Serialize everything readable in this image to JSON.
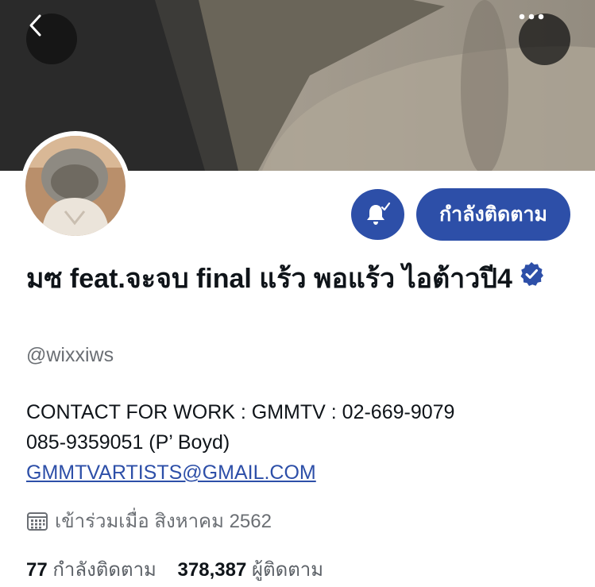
{
  "header": {
    "back_icon": "chevron-left-icon",
    "more_icon": "more-horizontal-icon"
  },
  "profile": {
    "avatar_alt": "avatar",
    "notification_icon": "bell-check-icon",
    "follow_button_label": "กำลังติดตาม",
    "display_name": "มซ feat.จะจบ final แร้ว พอแร้ว ไอต้าวปี4",
    "verified_icon": "verified-badge-icon",
    "handle": "@wixxiws",
    "bio": {
      "line1": "CONTACT FOR WORK : GMMTV : 02-669-9079",
      "line2": "085-9359051 (P’ Boyd)",
      "link": "GMMTVARTISTS@GMAIL.COM"
    },
    "joined_icon": "calendar-icon",
    "joined_text": "เข้าร่วมเมื่อ สิงหาคม 2562",
    "stats": {
      "following_count": "77",
      "following_label": "กำลังติดตาม",
      "followers_count": "378,387",
      "followers_label": "ผู้ติดตาม"
    }
  },
  "colors": {
    "accent": "#2d4fa8",
    "text_primary": "#0f1419",
    "text_secondary": "#6b6f74"
  }
}
